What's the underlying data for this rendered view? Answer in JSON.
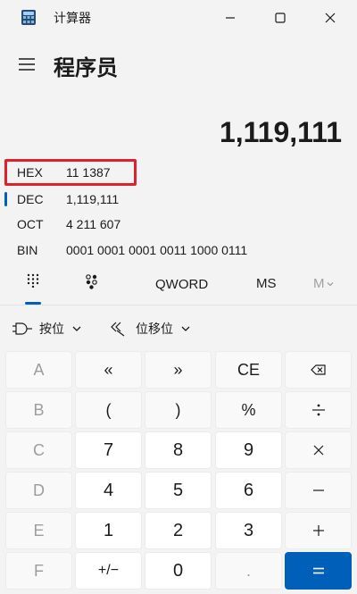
{
  "window": {
    "title": "计算器"
  },
  "header": {
    "mode_title": "程序员"
  },
  "display": {
    "value": "1,119,111"
  },
  "radix": [
    {
      "label": "HEX",
      "value": "11 1387"
    },
    {
      "label": "DEC",
      "value": "1,119,111"
    },
    {
      "label": "OCT",
      "value": "4 211 607"
    },
    {
      "label": "BIN",
      "value": "0001 0001 0001 0011 1000 0111"
    }
  ],
  "modebar": {
    "word_size": "QWORD",
    "ms": "MS",
    "m_dropdown": "M"
  },
  "dropdowns": {
    "bitwise": "按位",
    "bitshift": "位移位"
  },
  "keys": {
    "A": "A",
    "lshift": "«",
    "rshift": "»",
    "CE": "CE",
    "B": "B",
    "lparen": "(",
    "rparen": ")",
    "mod": "%",
    "C": "C",
    "n7": "7",
    "n8": "8",
    "n9": "9",
    "D": "D",
    "n4": "4",
    "n5": "5",
    "n6": "6",
    "E": "E",
    "n1": "1",
    "n2": "2",
    "n3": "3",
    "F": "F",
    "negate": "+/−",
    "n0": "0",
    "dot": "."
  },
  "colors": {
    "accent": "#005fb8",
    "highlight": "#e0202a",
    "background": "#f3f3f3"
  }
}
